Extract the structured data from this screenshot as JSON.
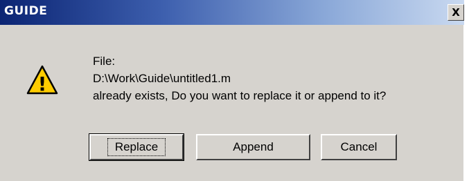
{
  "window": {
    "title": "GUIDE",
    "close_glyph": "X"
  },
  "icon": {
    "name": "warning-icon",
    "glyph": "!",
    "fill": "#ffcc00"
  },
  "message": {
    "line1": "File:",
    "line2": "D:\\Work\\Guide\\untitled1.m",
    "line3": "already exists, Do you want to replace it or append to it?"
  },
  "buttons": {
    "replace": "Replace",
    "append": "Append",
    "cancel": "Cancel"
  }
}
